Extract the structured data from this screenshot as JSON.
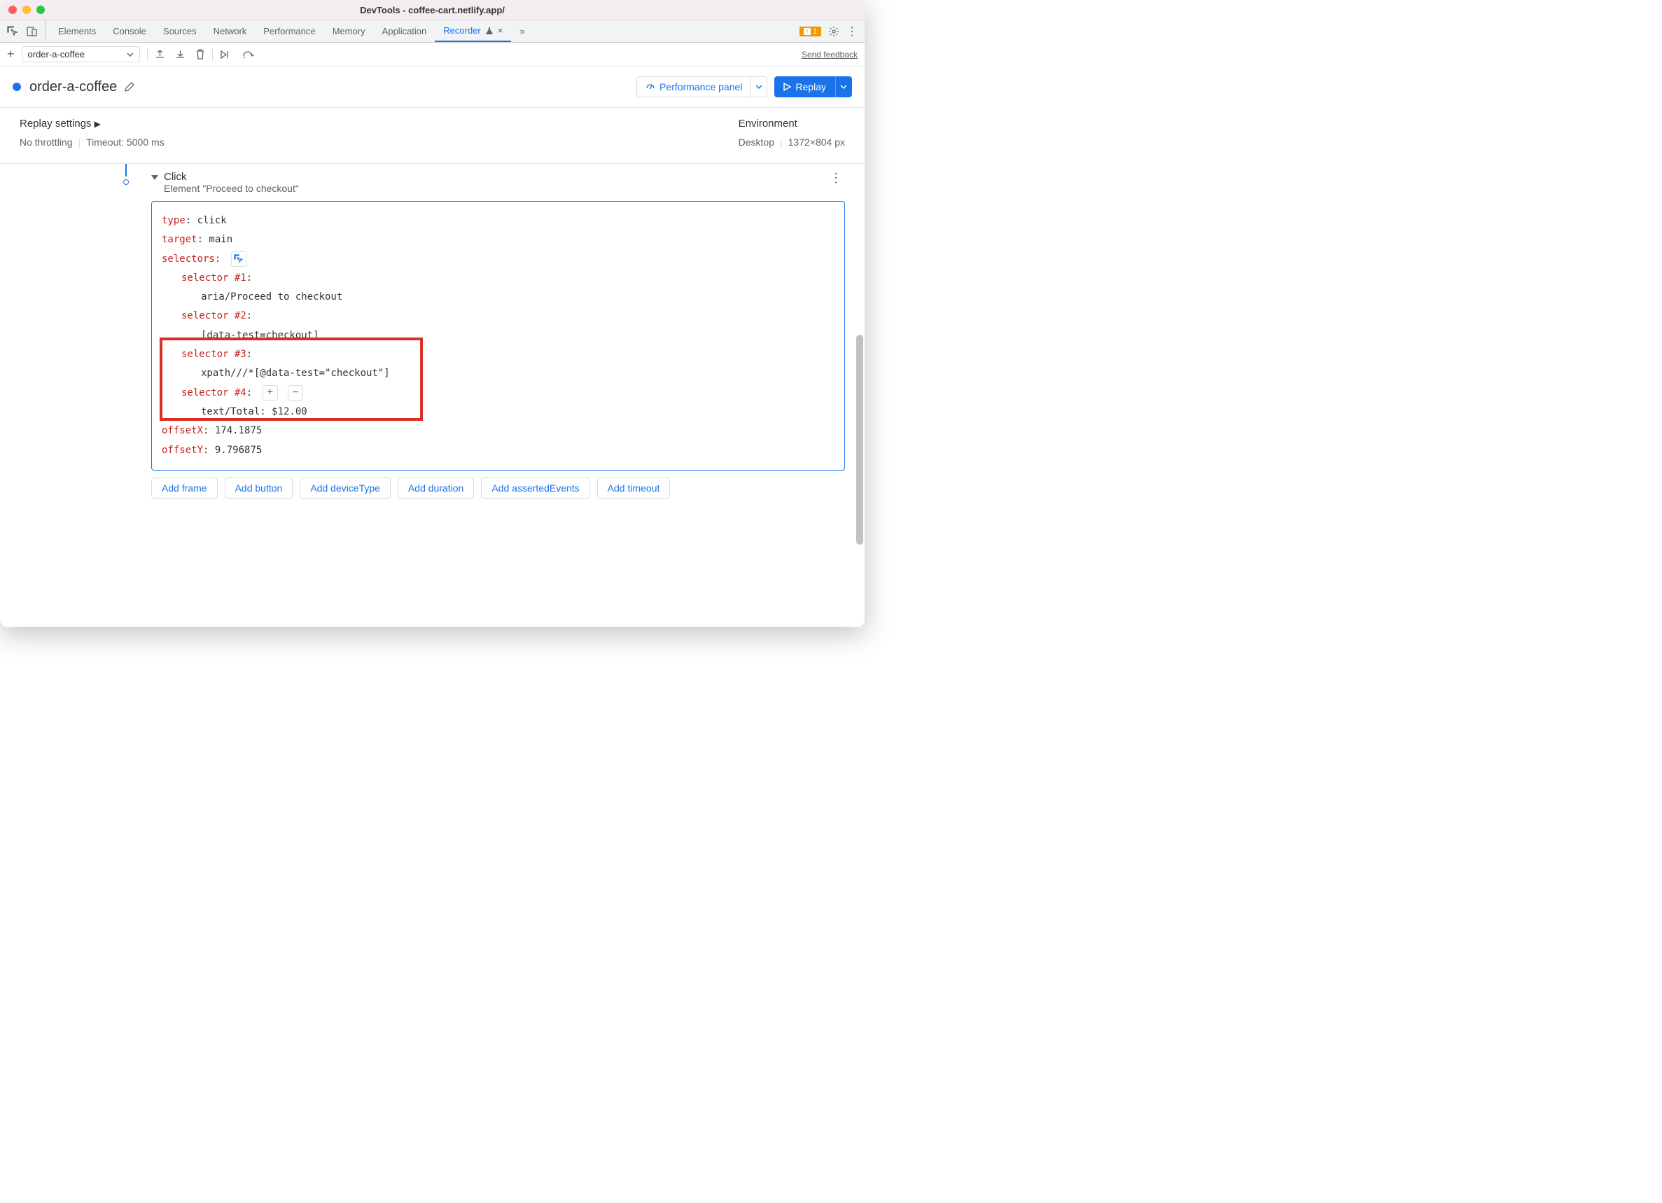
{
  "window": {
    "title": "DevTools - coffee-cart.netlify.app/"
  },
  "tabs": {
    "items": [
      "Elements",
      "Console",
      "Sources",
      "Network",
      "Performance",
      "Memory",
      "Application",
      "Recorder"
    ],
    "warnCount": "1"
  },
  "toolbar": {
    "recordingName": "order-a-coffee",
    "feedback": "Send feedback"
  },
  "header": {
    "title": "order-a-coffee",
    "perfButton": "Performance panel",
    "replayButton": "Replay"
  },
  "settings": {
    "replayTitle": "Replay settings",
    "throttling": "No throttling",
    "timeout": "Timeout: 5000 ms",
    "envTitle": "Environment",
    "device": "Desktop",
    "dimensions": "1372×804 px"
  },
  "step": {
    "title": "Click",
    "subtitle": "Element \"Proceed to checkout\"",
    "lines": {
      "typeKey": "type",
      "typeVal": ": click",
      "targetKey": "target",
      "targetVal": ": main",
      "selectorsKey": "selectors",
      "selectorsColon": ":",
      "sel1Key": "selector #1",
      "sel1Val": "aria/Proceed to checkout",
      "sel2Key": "selector #2",
      "sel2Val": "[data-test=checkout]",
      "sel3Key": "selector #3",
      "sel3Val": "xpath///*[@data-test=\"checkout\"]",
      "sel4Key": "selector #4",
      "sel4Val": "text/Total: $12.00",
      "offsetXKey": "offsetX",
      "offsetXVal": ": 174.1875",
      "offsetYKey": "offsetY",
      "offsetYVal": ": 9.796875",
      "colon": ":"
    }
  },
  "addButtons": [
    "Add frame",
    "Add button",
    "Add deviceType",
    "Add duration",
    "Add assertedEvents",
    "Add timeout"
  ]
}
